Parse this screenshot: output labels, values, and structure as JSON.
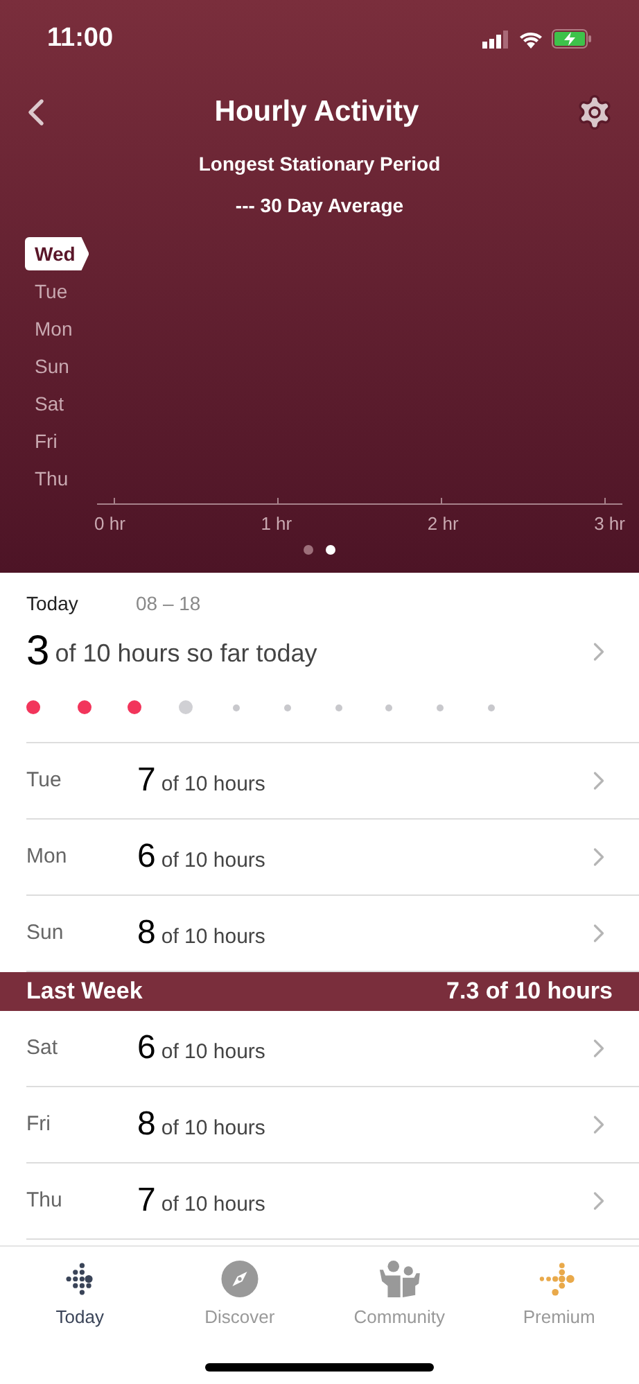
{
  "status_bar": {
    "time": "11:00"
  },
  "header": {
    "title": "Hourly Activity",
    "subtitle": "Longest Stationary Period",
    "legend": "--- 30 Day Average"
  },
  "chart": {
    "days": [
      {
        "label": "Wed",
        "selected": true
      },
      {
        "label": "Tue",
        "selected": false
      },
      {
        "label": "Mon",
        "selected": false
      },
      {
        "label": "Sun",
        "selected": false
      },
      {
        "label": "Sat",
        "selected": false
      },
      {
        "label": "Fri",
        "selected": false
      },
      {
        "label": "Thu",
        "selected": false
      }
    ],
    "ticks": [
      "0 hr",
      "1 hr",
      "2 hr",
      "3 hr"
    ],
    "pages": [
      {
        "selected": false
      },
      {
        "selected": true
      }
    ]
  },
  "today": {
    "label": "Today",
    "range": "08 – 18",
    "count": "3",
    "summary": "of 10 hours so far today",
    "hours": [
      {
        "kind": "met"
      },
      {
        "kind": "met"
      },
      {
        "kind": "met"
      },
      {
        "kind": "current"
      },
      {
        "kind": "future"
      },
      {
        "kind": "future"
      },
      {
        "kind": "future"
      },
      {
        "kind": "future"
      },
      {
        "kind": "future"
      },
      {
        "kind": "future"
      }
    ]
  },
  "this_week": [
    {
      "day": "Tue",
      "count": "7",
      "summary": "of 10 hours"
    },
    {
      "day": "Mon",
      "count": "6",
      "summary": "of 10 hours"
    },
    {
      "day": "Sun",
      "count": "8",
      "summary": "of 10 hours"
    }
  ],
  "last_week": {
    "title": "Last Week",
    "total": "7.3 of 10 hours",
    "days": [
      {
        "day": "Sat",
        "count": "6",
        "summary": "of 10 hours"
      },
      {
        "day": "Fri",
        "count": "8",
        "summary": "of 10 hours"
      },
      {
        "day": "Thu",
        "count": "7",
        "summary": "of 10 hours"
      }
    ]
  },
  "tab_bar": [
    {
      "label": "Today",
      "selected": true
    },
    {
      "label": "Discover",
      "selected": false
    },
    {
      "label": "Community",
      "selected": false
    },
    {
      "label": "Premium",
      "selected": false
    }
  ]
}
